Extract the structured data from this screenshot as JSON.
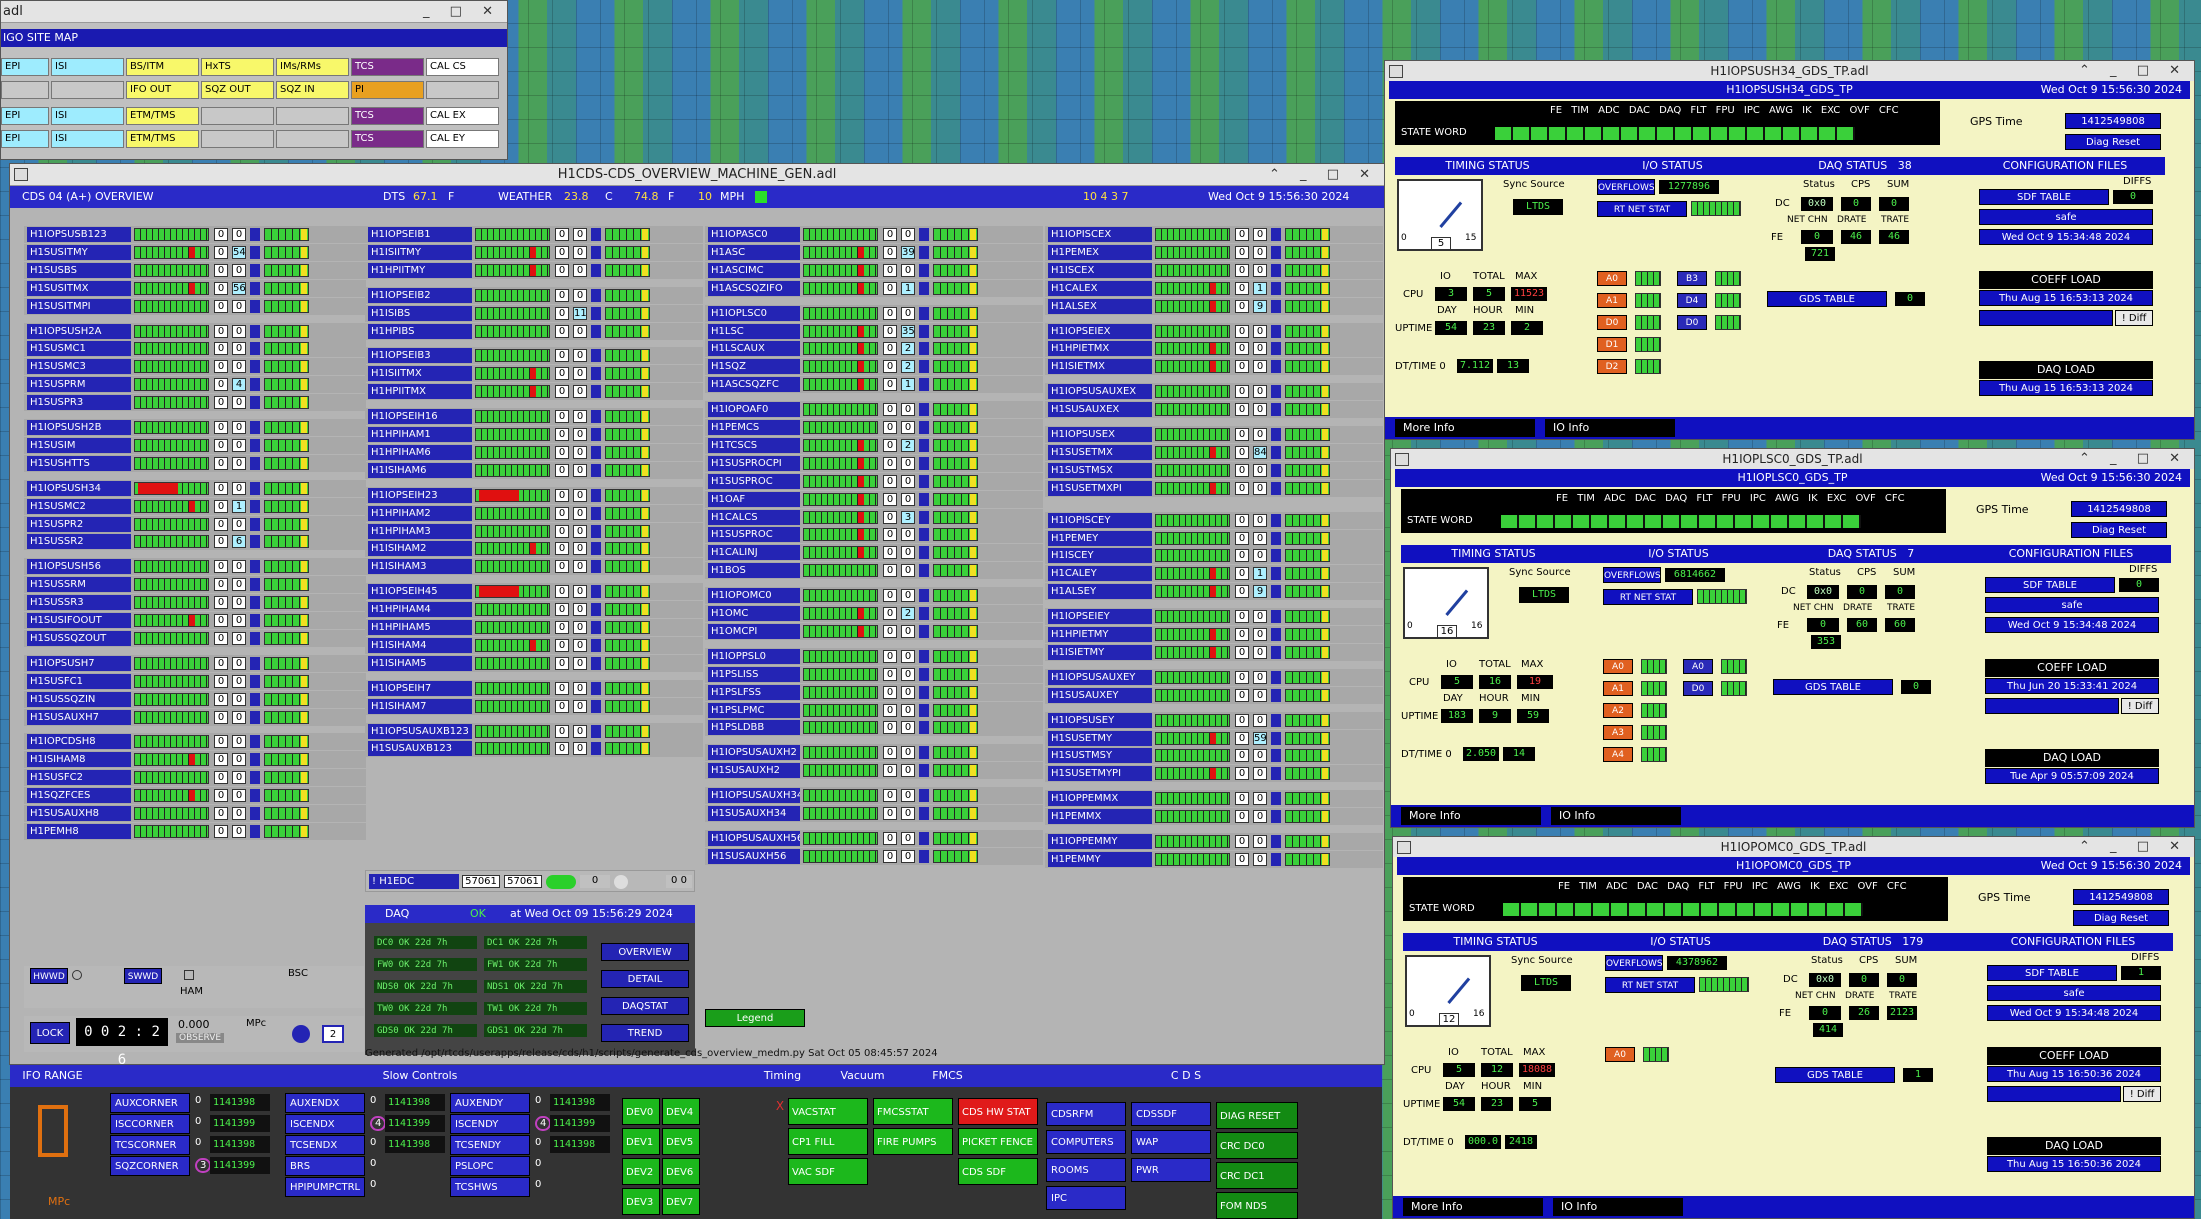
{
  "sitemap": {
    "title": "adl",
    "rows": [
      [
        {
          "t": "EPI",
          "c": "cy"
        },
        {
          "t": "ISI",
          "c": "cy"
        },
        {
          "t": "BS/ITM",
          "c": "yl"
        },
        {
          "t": "HxTS",
          "c": "yl"
        },
        {
          "t": "IMs/RMs",
          "c": "yl"
        },
        {
          "t": "TCS",
          "c": "pp"
        },
        {
          "t": "CAL CS",
          "c": "wh"
        }
      ],
      [
        {
          "t": "",
          "c": "gy"
        },
        {
          "t": "",
          "c": "gy"
        },
        {
          "t": "IFO OUT",
          "c": "yl"
        },
        {
          "t": "SQZ OUT",
          "c": "yl"
        },
        {
          "t": "SQZ IN",
          "c": "yl"
        },
        {
          "t": "PI",
          "c": "or"
        },
        {
          "t": "",
          "c": "gy"
        }
      ],
      [
        {
          "t": "EPI",
          "c": "cy"
        },
        {
          "t": "ISI",
          "c": "cy"
        },
        {
          "t": "ETM/TMS",
          "c": "yl"
        },
        {
          "t": "",
          "c": "gy"
        },
        {
          "t": "",
          "c": "gy"
        },
        {
          "t": "TCS",
          "c": "pp"
        },
        {
          "t": "CAL EX",
          "c": "wh"
        }
      ],
      [
        {
          "t": "EPI",
          "c": "cy"
        },
        {
          "t": "ISI",
          "c": "cy"
        },
        {
          "t": "ETM/TMS",
          "c": "yl"
        },
        {
          "t": "",
          "c": "gy"
        },
        {
          "t": "",
          "c": "gy"
        },
        {
          "t": "TCS",
          "c": "pp"
        },
        {
          "t": "CAL EY",
          "c": "wh"
        }
      ]
    ],
    "header": "IGO SITE MAP"
  },
  "overview": {
    "title": "H1CDS-CDS_OVERVIEW_MACHINE_GEN.adl",
    "heading": "CDS 04 (A+) OVERVIEW",
    "dts": "DTS",
    "dts_val": "67.1",
    "dts_unit": "F",
    "weather": "WEATHER",
    "w1": "23.8",
    "w1u": "C",
    "w2": "74.8",
    "w2u": "F",
    "w3": "10",
    "w3u": "MPH",
    "counts": "10  4  3  7",
    "datetime": "Wed Oct  9 15:56:30 2024",
    "col1": [
      [
        "H1IOPSUSB123",
        "",
        ""
      ],
      [
        "H1SUSITMY",
        "",
        "54"
      ],
      [
        "H1SUSBS",
        "",
        ""
      ],
      [
        "H1SUSITMX",
        "",
        "56"
      ],
      [
        "H1SUSITMPI",
        "",
        ""
      ],
      null,
      [
        "H1IOPSUSH2A",
        "",
        ""
      ],
      [
        "H1SUSMC1",
        "",
        ""
      ],
      [
        "H1SUSMC3",
        "",
        ""
      ],
      [
        "H1SUSPRM",
        "",
        "4"
      ],
      [
        "H1SUSPR3",
        "",
        ""
      ],
      null,
      [
        "H1IOPSUSH2B",
        "",
        ""
      ],
      [
        "H1SUSIM",
        "",
        ""
      ],
      [
        "H1SUSHTTS",
        "",
        ""
      ],
      null,
      [
        "H1IOPSUSH34",
        "",
        ""
      ],
      [
        "H1SUSMC2",
        "",
        "1"
      ],
      [
        "H1SUSPR2",
        "",
        ""
      ],
      [
        "H1SUSSR2",
        "",
        "6"
      ],
      null,
      [
        "H1IOPSUSH56",
        "",
        ""
      ],
      [
        "H1SUSSRM",
        "",
        ""
      ],
      [
        "H1SUSSR3",
        "",
        ""
      ],
      [
        "H1SUSIFOOUT",
        "",
        ""
      ],
      [
        "H1SUSSQZOUT",
        "",
        ""
      ],
      null,
      [
        "H1IOPSUSH7",
        "",
        ""
      ],
      [
        "H1SUSFC1",
        "",
        ""
      ],
      [
        "H1SUSSQZIN",
        "",
        ""
      ],
      [
        "H1SUSAUXH7",
        "",
        ""
      ],
      null,
      [
        "H1IOPCDSH8",
        "",
        ""
      ],
      [
        "H1ISIHAM8",
        "",
        ""
      ],
      [
        "H1SUSFC2",
        "",
        ""
      ],
      [
        "H1SQZFCES",
        "",
        ""
      ],
      [
        "H1SUSAUXH8",
        "",
        ""
      ],
      [
        "H1PEMH8",
        "",
        ""
      ]
    ],
    "col2": [
      [
        "H1IOPSEIB1",
        "",
        ""
      ],
      [
        "H1ISIITMY",
        "",
        ""
      ],
      [
        "H1HPIITMY",
        "",
        ""
      ],
      null,
      [
        "H1IOPSEIB2",
        "",
        ""
      ],
      [
        "H1ISIBS",
        "",
        "11"
      ],
      [
        "H1HPIBS",
        "",
        ""
      ],
      null,
      [
        "H1IOPSEIB3",
        "",
        ""
      ],
      [
        "H1ISIITMX",
        "",
        ""
      ],
      [
        "H1HPIITMX",
        "",
        ""
      ],
      null,
      [
        "H1IOPSEIH16",
        "",
        ""
      ],
      [
        "H1HPIHAM1",
        "",
        ""
      ],
      [
        "H1HPIHAM6",
        "",
        ""
      ],
      [
        "H1ISIHAM6",
        "",
        ""
      ],
      null,
      [
        "H1IOPSEIH23",
        "",
        ""
      ],
      [
        "H1HPIHAM2",
        "",
        ""
      ],
      [
        "H1HPIHAM3",
        "",
        ""
      ],
      [
        "H1ISIHAM2",
        "",
        ""
      ],
      [
        "H1ISIHAM3",
        "",
        ""
      ],
      null,
      [
        "H1IOPSEIH45",
        "",
        ""
      ],
      [
        "H1HPIHAM4",
        "",
        ""
      ],
      [
        "H1HPIHAM5",
        "",
        ""
      ],
      [
        "H1ISIHAM4",
        "",
        ""
      ],
      [
        "H1ISIHAM5",
        "",
        ""
      ],
      null,
      [
        "H1IOPSEIH7",
        "",
        ""
      ],
      [
        "H1ISIHAM7",
        "",
        ""
      ],
      null,
      [
        "H1IOPSUSAUXB123",
        "",
        ""
      ],
      [
        "H1SUSAUXB123",
        "",
        ""
      ]
    ],
    "col3": [
      [
        "H1IOPASC0",
        "",
        ""
      ],
      [
        "H1ASC",
        "",
        "39"
      ],
      [
        "H1ASCIMC",
        "",
        ""
      ],
      [
        "H1ASCSQZIFO",
        "",
        "1"
      ],
      null,
      [
        "H1IOPLSC0",
        "",
        ""
      ],
      [
        "H1LSC",
        "",
        "35"
      ],
      [
        "H1LSCAUX",
        "",
        "2"
      ],
      [
        "H1SQZ",
        "",
        "2"
      ],
      [
        "H1ASCSQZFC",
        "",
        "1"
      ],
      null,
      [
        "H1IOPOAF0",
        "",
        ""
      ],
      [
        "H1PEMCS",
        "",
        ""
      ],
      [
        "H1TCSCS",
        "",
        "2"
      ],
      [
        "H1SUSPROCPI",
        "",
        ""
      ],
      [
        "H1SUSPROC",
        "",
        ""
      ],
      [
        "H1OAF",
        "",
        ""
      ],
      [
        "H1CALCS",
        "",
        "3"
      ],
      [
        "H1SUSPROC",
        "",
        ""
      ],
      [
        "H1CALINJ",
        "",
        ""
      ],
      [
        "H1BOS",
        "",
        ""
      ],
      null,
      [
        "H1IOPOMC0",
        "",
        ""
      ],
      [
        "H1OMC",
        "",
        "2"
      ],
      [
        "H1OMCPI",
        "",
        ""
      ],
      null,
      [
        "H1IOPPSL0",
        "",
        ""
      ],
      [
        "H1PSLISS",
        "",
        ""
      ],
      [
        "H1PSLFSS",
        "",
        ""
      ],
      [
        "H1PSLPMC",
        "",
        ""
      ],
      [
        "H1PSLDBB",
        "",
        ""
      ],
      null,
      [
        "H1IOPSUSAUXH2",
        "",
        ""
      ],
      [
        "H1SUSAUXH2",
        "",
        ""
      ],
      null,
      [
        "H1IOPSUSAUXH34",
        "",
        ""
      ],
      [
        "H1SUSAUXH34",
        "",
        ""
      ],
      null,
      [
        "H1IOPSUSAUXH56",
        "",
        ""
      ],
      [
        "H1SUSAUXH56",
        "",
        ""
      ]
    ],
    "col4": [
      [
        "H1IOPISCEX",
        "",
        ""
      ],
      [
        "H1PEMEX",
        "",
        ""
      ],
      [
        "H1ISCEX",
        "",
        ""
      ],
      [
        "H1CALEX",
        "",
        "1"
      ],
      [
        "H1ALSEX",
        "",
        "9"
      ],
      null,
      [
        "H1IOPSEIEX",
        "",
        ""
      ],
      [
        "H1HPIETMX",
        "",
        ""
      ],
      [
        "H1ISIETMX",
        "",
        ""
      ],
      null,
      [
        "H1IOPSUSAUXEX",
        "",
        ""
      ],
      [
        "H1SUSAUXEX",
        "",
        ""
      ],
      null,
      [
        "H1IOPSUSEX",
        "",
        ""
      ],
      [
        "H1SUSETMX",
        "",
        "84"
      ],
      [
        "H1SUSTMSX",
        "",
        ""
      ],
      [
        "H1SUSETMXPI",
        "",
        ""
      ],
      null,
      null,
      [
        "H1IOPISCEY",
        "",
        ""
      ],
      [
        "H1PEMEY",
        "",
        ""
      ],
      [
        "H1ISCEY",
        "",
        ""
      ],
      [
        "H1CALEY",
        "",
        "1"
      ],
      [
        "H1ALSEY",
        "",
        "9"
      ],
      null,
      [
        "H1IOPSEIEY",
        "",
        ""
      ],
      [
        "H1HPIETMY",
        "",
        ""
      ],
      [
        "H1ISIETMY",
        "",
        ""
      ],
      null,
      [
        "H1IOPSUSAUXEY",
        "",
        ""
      ],
      [
        "H1SUSAUXEY",
        "",
        ""
      ],
      null,
      [
        "H1IOPSUSEY",
        "",
        ""
      ],
      [
        "H1SUSETMY",
        "",
        "59"
      ],
      [
        "H1SUSTMSY",
        "",
        ""
      ],
      [
        "H1SUSETMYPI",
        "",
        ""
      ],
      null,
      [
        "H1IOPPEMMX",
        "",
        ""
      ],
      [
        "H1PEMMX",
        "",
        ""
      ],
      null,
      [
        "H1IOPPEMMY",
        "",
        ""
      ],
      [
        "H1PEMMY",
        "",
        ""
      ]
    ],
    "edc": {
      "label": "! H1EDC",
      "v1": "57061",
      "v2": "57061",
      "v3": "0",
      "v4": "0 0"
    },
    "daq": {
      "label": "DAQ",
      "ok": "OK",
      "at": "at Wed Oct 09 15:56:29 2024",
      "cells": [
        "DC0 OK  22d 7h",
        "DC1 OK  22d 7h",
        "FW0 OK  22d 7h",
        "FW1 OK  22d 7h",
        "NDS0 OK  22d 7h",
        "NDS1 OK  22d 7h",
        "TW0 OK  22d 7h",
        "TW1 OK  22d 7h",
        "GDS0 OK  22d 7h",
        "GDS1 OK  22d 7h"
      ],
      "buttons": [
        "OVERVIEW",
        "DETAIL",
        "DAQSTAT",
        "TREND"
      ]
    },
    "legend": "Legend",
    "generated": "Generated /opt/rtcds/userapps/release/cds/h1/scripts/generate_cds_overview_medm.py Sat Oct 05 08:45:57 2024",
    "lock": {
      "label": "LOCK",
      "time": "0 0 2 : 2 6",
      "mpc_val": "0.000",
      "mpc_unit": "MPc",
      "observe": "OBSERVE",
      "num": "2",
      "hwwd": "HWWD",
      "swwd": "SWWD",
      "ham": "HAM",
      "bsc": "BSC"
    },
    "bottom": {
      "ifo_range": "IFO RANGE",
      "ifo_unit": "MPc",
      "ifo_digit": "0",
      "slow": "Slow Controls",
      "timing": "Timing",
      "timing_x": "X",
      "vacuum": "Vacuum",
      "fmcs": "FMCS",
      "cds": "C D S",
      "slow_items": [
        [
          "AUXCORNER",
          "0",
          "1141398"
        ],
        [
          "ISCCORNER",
          "0",
          "1141399"
        ],
        [
          "TCSCORNER",
          "0",
          "1141398"
        ],
        [
          "SQZCORNER",
          "3",
          "1141399"
        ]
      ],
      "slow_items2": [
        [
          "AUXENDX",
          "0",
          "1141398"
        ],
        [
          "ISCENDX",
          "4",
          "1141399"
        ],
        [
          "TCSENDX",
          "0",
          "1141398"
        ],
        [
          "BRS",
          "0",
          ""
        ],
        [
          "HPIPUMPCTRL",
          "0",
          ""
        ]
      ],
      "slow_items3": [
        [
          "AUXENDY",
          "0",
          "1141398"
        ],
        [
          "ISCENDY",
          "4",
          "1141399"
        ],
        [
          "TCSENDY",
          "0",
          "1141398"
        ],
        [
          "PSLOPC",
          "0",
          ""
        ],
        [
          "TCSHWS",
          "0",
          ""
        ]
      ],
      "dev": [
        "DEV0",
        "DEV4",
        "DEV1",
        "DEV5",
        "DEV2",
        "DEV6",
        "DEV3",
        "DEV7"
      ],
      "vac": [
        "VACSTAT",
        "CP1 FILL",
        "VAC SDF"
      ],
      "fmcsb": [
        "FMCSSTAT",
        "FIRE PUMPS"
      ],
      "cdsb": [
        "CDS HW STAT",
        "PICKET FENCE",
        "CDS SDF"
      ],
      "cdsblue": [
        "CDSRFM",
        "CDSSDF",
        "COMPUTERS",
        "WAP",
        "ROOMS",
        "PWR",
        "IPC"
      ],
      "diag": [
        "DIAG RESET",
        "CRC DC0",
        "CRC DC1",
        "FOM NDS"
      ]
    }
  },
  "gds": [
    {
      "title": "H1IOPSUSH34_GDS_TP.adl",
      "sub": "H1IOPSUSH34_GDS_TP",
      "dt": "Wed Oct  9 15:56:30 2024",
      "gps_lbl": "GPS Time",
      "gps": "1412549808",
      "diag": "Diag Reset",
      "hdr": "FE  TIM  ADC  DAC  DAQ  FLT  FPU  IPC  AWG  IK  EXC  OVF  CFC",
      "stw": "STATE WORD",
      "timing": "TIMING STATUS",
      "io": "I/O STATUS",
      "daqst": "DAQ STATUS",
      "daqn": "38",
      "cfg": "CONFIGURATION FILES",
      "sync": "Sync Source",
      "ltds": "LTDS",
      "dial": "5",
      "d0": "0",
      "d15": "15",
      "ovf": "OVERFLOWS",
      "ovfv": "1277896",
      "rtnet": "RT NET STAT",
      "status": "Status",
      "cps": "CPS",
      "sum": "SUM",
      "dc": "DC",
      "x0": "0x0",
      "z": "0",
      "netchn": "NET CHN",
      "drate": "DRATE",
      "trate": "TRATE",
      "fe": "FE",
      "n1": "0",
      "n2": "46",
      "n3": "46",
      "n4": "721",
      "cpu": "CPU",
      "io_l": "IO",
      "tot": "TOTAL",
      "max": "MAX",
      "c1": "3",
      "c2": "5",
      "c3": "11523",
      "day": "DAY",
      "hour": "HOUR",
      "min": "MIN",
      "u1": "54",
      "u2": "23",
      "u3": "2",
      "uptime": "UPTIME",
      "dtt": "DT/TIME 0",
      "t1": "7.112",
      "t2": "13",
      "sdf": "SDF TABLE",
      "diffs": "DIFFS",
      "dv": "0",
      "safe": "safe",
      "sdfdate": "Wed Oct  9 15:34:48 2024",
      "coeff": "COEFF LOAD",
      "cdate": "Thu Aug 15 16:53:13 2024",
      "diff": "! Diff",
      "daqload": "DAQ LOAD",
      "ddate": "Thu Aug 15 16:53:13 2024",
      "gdstab": "GDS TABLE",
      "gv": "0",
      "more": "More Info",
      "ioinfo": "IO Info",
      "adc": [
        "A0",
        "A1",
        "D0",
        "D1",
        "D2"
      ],
      "adc2": [
        "B3",
        "D4",
        "D0"
      ]
    },
    {
      "title": "H1IOPLSC0_GDS_TP.adl",
      "sub": "H1IOPLSC0_GDS_TP",
      "dt": "Wed Oct  9 15:56:30 2024",
      "gps_lbl": "GPS Time",
      "gps": "1412549808",
      "diag": "Diag Reset",
      "hdr": "FE  TIM  ADC  DAC  DAQ  FLT  FPU  IPC  AWG  IK  EXC  OVF  CFC",
      "stw": "STATE WORD",
      "timing": "TIMING STATUS",
      "io": "I/O STATUS",
      "daqst": "DAQ STATUS",
      "daqn": "7",
      "cfg": "CONFIGURATION FILES",
      "sync": "Sync Source",
      "ltds": "LTDS",
      "dial": "16",
      "d0": "0",
      "d15": "16",
      "ovf": "OVERFLOWS",
      "ovfv": "6814662",
      "rtnet": "RT NET STAT",
      "status": "Status",
      "cps": "CPS",
      "sum": "SUM",
      "dc": "DC",
      "x0": "0x0",
      "z": "0",
      "netchn": "NET CHN",
      "drate": "DRATE",
      "trate": "TRATE",
      "fe": "FE",
      "n1": "0",
      "n2": "60",
      "n3": "60",
      "n4": "353",
      "cpu": "CPU",
      "io_l": "IO",
      "tot": "TOTAL",
      "max": "MAX",
      "c1": "5",
      "c2": "16",
      "c3": "19",
      "day": "DAY",
      "hour": "HOUR",
      "min": "MIN",
      "u1": "183",
      "u2": "9",
      "u3": "59",
      "uptime": "UPTIME",
      "dtt": "DT/TIME 0",
      "t1": "2.050",
      "t2": "14",
      "sdf": "SDF TABLE",
      "diffs": "DIFFS",
      "dv": "0",
      "safe": "safe",
      "sdfdate": "Wed Oct  9 15:34:48 2024",
      "coeff": "COEFF LOAD",
      "cdate": "Thu Jun 20 15:33:41 2024",
      "diff": "! Diff",
      "daqload": "DAQ LOAD",
      "ddate": "Tue Apr  9 05:57:09 2024",
      "gdstab": "GDS TABLE",
      "gv": "0",
      "more": "More Info",
      "ioinfo": "IO Info",
      "adc": [
        "A0",
        "A1",
        "A2",
        "A3",
        "A4"
      ],
      "adc2": [
        "A0",
        "D0"
      ]
    },
    {
      "title": "H1IOPOMC0_GDS_TP.adl",
      "sub": "H1IOPOMC0_GDS_TP",
      "dt": "Wed Oct  9 15:56:30 2024",
      "gps_lbl": "GPS Time",
      "gps": "1412549808",
      "diag": "Diag Reset",
      "hdr": "FE  TIM  ADC  DAC  DAQ  FLT  FPU  IPC  AWG  IK  EXC  OVF  CFC",
      "stw": "STATE WORD",
      "timing": "TIMING STATUS",
      "io": "I/O STATUS",
      "daqst": "DAQ STATUS",
      "daqn": "179",
      "cfg": "CONFIGURATION FILES",
      "sync": "Sync Source",
      "ltds": "LTDS",
      "dial": "12",
      "d0": "0",
      "d15": "16",
      "ovf": "OVERFLOWS",
      "ovfv": "4378962",
      "rtnet": "RT NET STAT",
      "status": "Status",
      "cps": "CPS",
      "sum": "SUM",
      "dc": "DC",
      "x0": "0x0",
      "z": "0",
      "netchn": "NET CHN",
      "drate": "DRATE",
      "trate": "TRATE",
      "fe": "FE",
      "n1": "0",
      "n2": "26",
      "n3": "2123",
      "n4": "414",
      "cpu": "CPU",
      "io_l": "IO",
      "tot": "TOTAL",
      "max": "MAX",
      "c1": "5",
      "c2": "12",
      "c3": "18088",
      "day": "DAY",
      "hour": "HOUR",
      "min": "MIN",
      "u1": "54",
      "u2": "23",
      "u3": "5",
      "uptime": "UPTIME",
      "dtt": "DT/TIME 0",
      "t1": "000.0",
      "t2": "2418",
      "sdf": "SDF TABLE",
      "diffs": "DIFFS",
      "dv": "1",
      "safe": "safe",
      "sdfdate": "Wed Oct  9 15:34:48 2024",
      "coeff": "COEFF LOAD",
      "cdate": "Thu Aug 15 16:50:36 2024",
      "diff": "! Diff",
      "daqload": "DAQ LOAD",
      "ddate": "Thu Aug 15 16:50:36 2024",
      "gdstab": "GDS TABLE",
      "gv": "1",
      "more": "More Info",
      "ioinfo": "IO Info",
      "adc": [
        "A0"
      ],
      "adc2": []
    }
  ]
}
